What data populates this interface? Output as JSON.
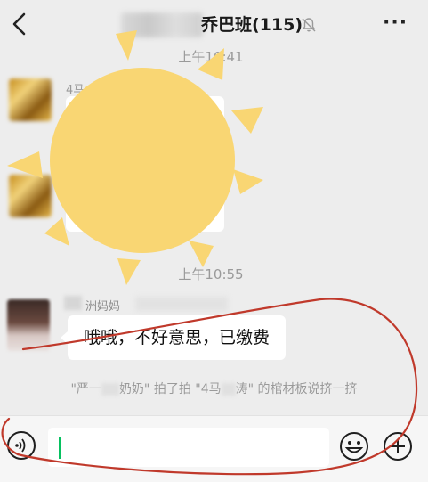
{
  "header": {
    "back_icon": "chevron-left-icon",
    "title_visible": "乔巴班(115)",
    "mute_icon": "bell-off-icon",
    "more_icon": "more-icon",
    "more_label": "···"
  },
  "messages": {
    "time1": "上午10:41",
    "sender1_fragment": "4马",
    "time2": "上午10:55",
    "sender2_visible": "洲妈妈",
    "message_text": "哦哦，不好意思，已缴费",
    "pat_prefix": "\"严一",
    "pat_middle": "奶奶\" 拍了拍 \"4马",
    "pat_suffix": "涛\" 的棺材板说挤一挤"
  },
  "input_bar": {
    "voice_icon": "voice-icon",
    "emoji_icon": "emoji-icon",
    "plus_icon": "plus-icon",
    "value": ""
  },
  "colors": {
    "background": "#ededed",
    "sun": "#f9d673",
    "annotation": "#c0392b",
    "caret": "#07c160"
  }
}
